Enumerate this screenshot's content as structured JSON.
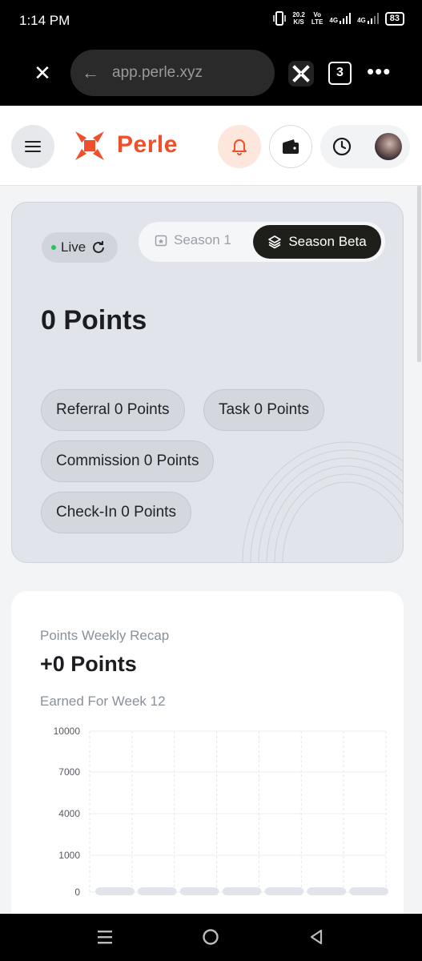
{
  "status_bar": {
    "time": "1:14 PM",
    "net_speed": "20.2",
    "net_unit": "K/S",
    "vo": "Vo",
    "lte": "LTE",
    "sig1": "4G",
    "sig2": "4G",
    "battery": "83"
  },
  "browser": {
    "url": "app.perle.xyz",
    "tab_count": "3"
  },
  "header": {
    "brand": "Perle"
  },
  "points_card": {
    "live_label": "Live",
    "season_1_label": "Season 1",
    "season_beta_label": "Season Beta",
    "total": "0 Points",
    "chips": {
      "referral": "Referral 0 Points",
      "task": "Task 0 Points",
      "commission": "Commission 0 Points",
      "checkin": "Check-In 0 Points"
    }
  },
  "recap": {
    "title": "Points Weekly Recap",
    "points": "+0 Points",
    "week": "Earned For Week 12"
  },
  "chart_data": {
    "type": "bar",
    "y_ticks": [
      "10000",
      "7000",
      "4000",
      "1000",
      "0"
    ],
    "ylim": [
      0,
      10000
    ],
    "values": [
      0,
      0,
      0,
      0,
      0,
      0,
      0
    ]
  },
  "colors": {
    "brand": "#ef4f2a",
    "live": "#22c55e"
  },
  "icons": [
    "close-icon",
    "back-arrow-icon",
    "extension-icon",
    "more-icon",
    "menu-icon",
    "bell-icon",
    "wallet-icon",
    "clock-icon",
    "refresh-icon",
    "calendar-icon",
    "layers-icon"
  ]
}
